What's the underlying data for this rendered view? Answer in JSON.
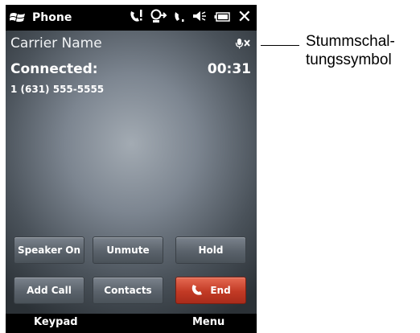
{
  "statusbar": {
    "app_title": "Phone",
    "close_glyph": "✕"
  },
  "call": {
    "carrier": "Carrier Name",
    "state": "Connected:",
    "timer": "00:31",
    "number": "1 (631) 555-5555"
  },
  "buttons": {
    "speaker": "Speaker On",
    "unmute": "Unmute",
    "hold": "Hold",
    "add_call": "Add Call",
    "contacts": "Contacts",
    "end": "End"
  },
  "softkeys": {
    "left": "Keypad",
    "right": "Menu"
  },
  "callout": {
    "text": "Stummschal-\ntungssymbol"
  },
  "colors": {
    "end_button": "#c23a25",
    "statusbar": "#000000"
  }
}
